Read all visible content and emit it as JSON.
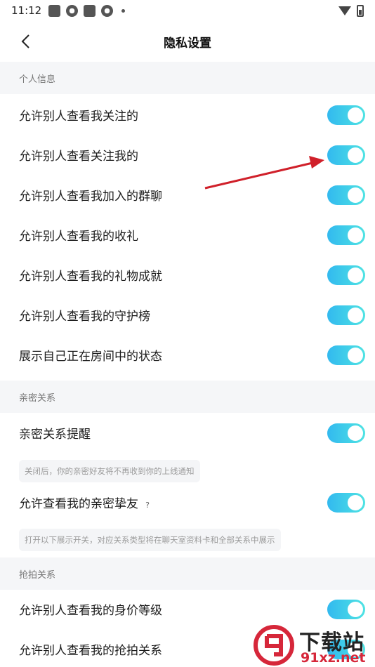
{
  "status_bar": {
    "time": "11:12"
  },
  "header": {
    "title": "隐私设置"
  },
  "sections": {
    "personal": {
      "title": "个人信息",
      "items": [
        {
          "label": "允许别人查看我关注的",
          "enabled": true
        },
        {
          "label": "允许别人查看关注我的",
          "enabled": true
        },
        {
          "label": "允许别人查看我加入的群聊",
          "enabled": true
        },
        {
          "label": "允许别人查看我的收礼",
          "enabled": true
        },
        {
          "label": "允许别人查看我的礼物成就",
          "enabled": true
        },
        {
          "label": "允许别人查看我的守护榜",
          "enabled": true
        },
        {
          "label": "展示自己正在房间中的状态",
          "enabled": true
        }
      ]
    },
    "intimate": {
      "title": "亲密关系",
      "items": [
        {
          "label": "亲密关系提醒",
          "enabled": true,
          "hint": "关闭后，你的亲密好友将不再收到你的上线通知"
        },
        {
          "label": "允许查看我的亲密挚友",
          "help": "?",
          "enabled": true,
          "hint": "打开以下展示开关，对应关系类型将在聊天室资料卡和全部关系中展示"
        }
      ]
    },
    "grab": {
      "title": "抢拍关系",
      "items": [
        {
          "label": "允许别人查看我的身价等级",
          "enabled": true
        },
        {
          "label": "允许别人查看我的抢拍关系",
          "enabled": true
        }
      ]
    }
  },
  "watermark": {
    "title": "下载站",
    "url": "91xz.net"
  },
  "colors": {
    "toggle_start": "#32b9ef",
    "toggle_end": "#4fe3e3",
    "arrow": "#d0202a",
    "watermark_red": "#d6273a"
  }
}
